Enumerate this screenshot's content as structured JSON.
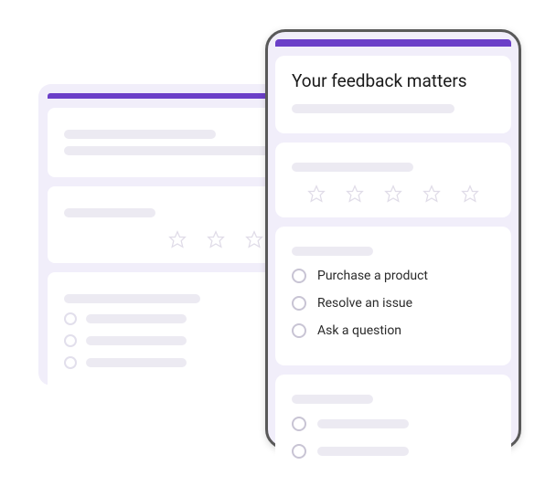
{
  "colors": {
    "accent": "#6b3fc8",
    "panel_bg": "#f1eefa",
    "placeholder": "#eceaf2",
    "border_dark": "#595959"
  },
  "front": {
    "title": "Your feedback matters",
    "options": [
      {
        "label": "Purchase a product"
      },
      {
        "label": "Resolve an issue"
      },
      {
        "label": "Ask a question"
      }
    ],
    "star_count": 5
  },
  "back": {
    "star_count": 3,
    "radio_count": 3
  }
}
